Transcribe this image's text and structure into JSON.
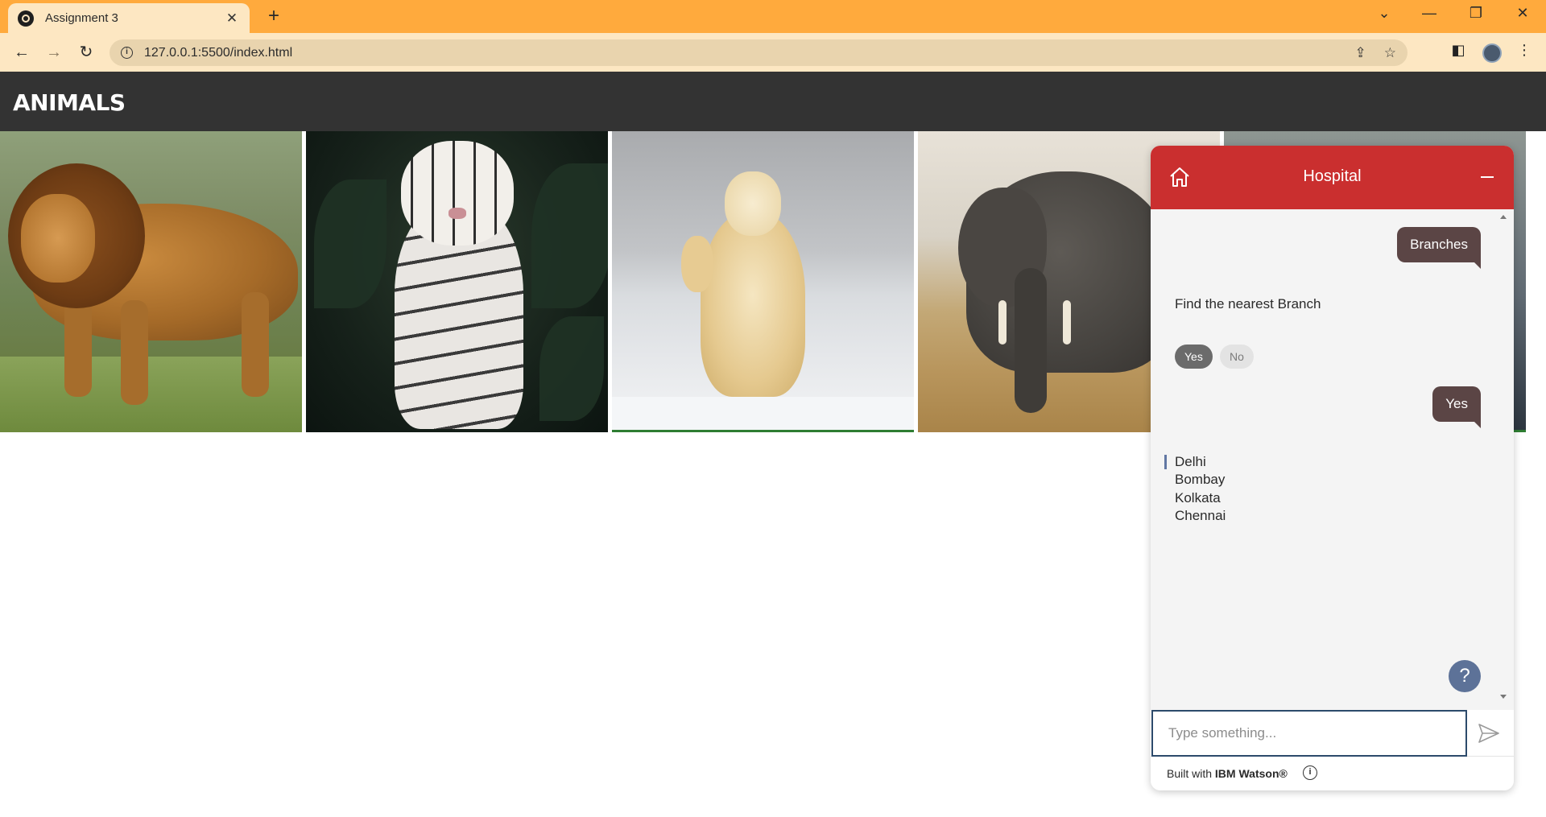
{
  "browser": {
    "tab_title": "Assignment 3",
    "tab_close": "✕",
    "new_tab": "+",
    "url": "127.0.0.1:5500/index.html"
  },
  "page": {
    "header_title": "ANIMALS",
    "images": [
      "lion",
      "white-tiger",
      "polar-bear",
      "elephant",
      "landscape"
    ]
  },
  "chat": {
    "title": "Hospital",
    "messages": {
      "user_1": "Branches",
      "bot_1": "Find the nearest Branch",
      "option_yes": "Yes",
      "option_no": "No",
      "user_2": "Yes"
    },
    "branches": [
      "Delhi",
      "Bombay",
      "Kolkata",
      "Chennai"
    ],
    "help_label": "?",
    "input_placeholder": "Type something...",
    "footer_prefix": "Built with ",
    "footer_brand": "IBM Watson®",
    "footer_info": "i"
  },
  "colors": {
    "chrome_orange": "#ffaa3d",
    "header_dark": "#333333",
    "chat_header_red": "#ca2f2f",
    "user_bubble": "#5b4545",
    "help_button": "#5d7298"
  }
}
